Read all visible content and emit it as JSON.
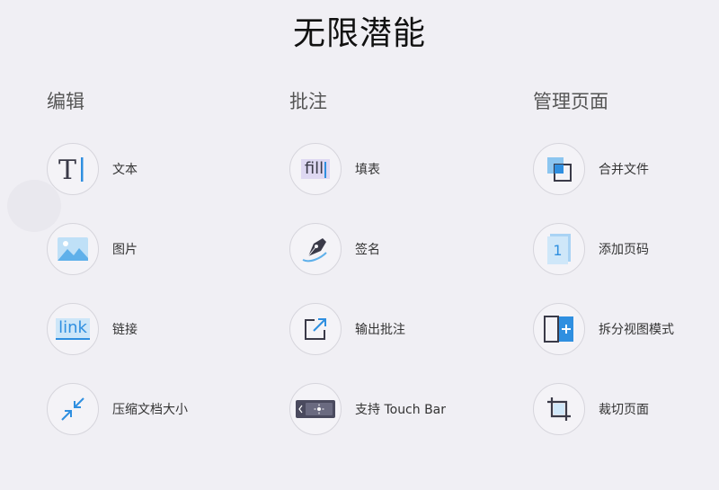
{
  "page": {
    "title": "无限潜能"
  },
  "columns": [
    {
      "heading": "编辑",
      "items": [
        {
          "label": "文本",
          "icon": "text-cursor-icon"
        },
        {
          "label": "图片",
          "icon": "image-icon"
        },
        {
          "label": "链接",
          "icon": "link-icon",
          "icon_text": "link"
        },
        {
          "label": "压缩文档大小",
          "icon": "compress-arrows-icon"
        }
      ]
    },
    {
      "heading": "批注",
      "items": [
        {
          "label": "填表",
          "icon": "fill-form-icon",
          "icon_text": "fill"
        },
        {
          "label": "签名",
          "icon": "pen-nib-icon"
        },
        {
          "label": "输出批注",
          "icon": "export-arrow-icon"
        },
        {
          "label": "支持 Touch Bar",
          "icon": "touch-bar-icon"
        }
      ]
    },
    {
      "heading": "管理页面",
      "items": [
        {
          "label": "合并文件",
          "icon": "merge-squares-icon"
        },
        {
          "label": "添加页码",
          "icon": "page-number-icon",
          "icon_text": "1"
        },
        {
          "label": "拆分视图模式",
          "icon": "split-view-icon"
        },
        {
          "label": "裁切页面",
          "icon": "crop-icon"
        }
      ]
    }
  ],
  "colors": {
    "accent": "#2f8fe0",
    "dark": "#3a3a48",
    "background": "#f0eff4"
  }
}
